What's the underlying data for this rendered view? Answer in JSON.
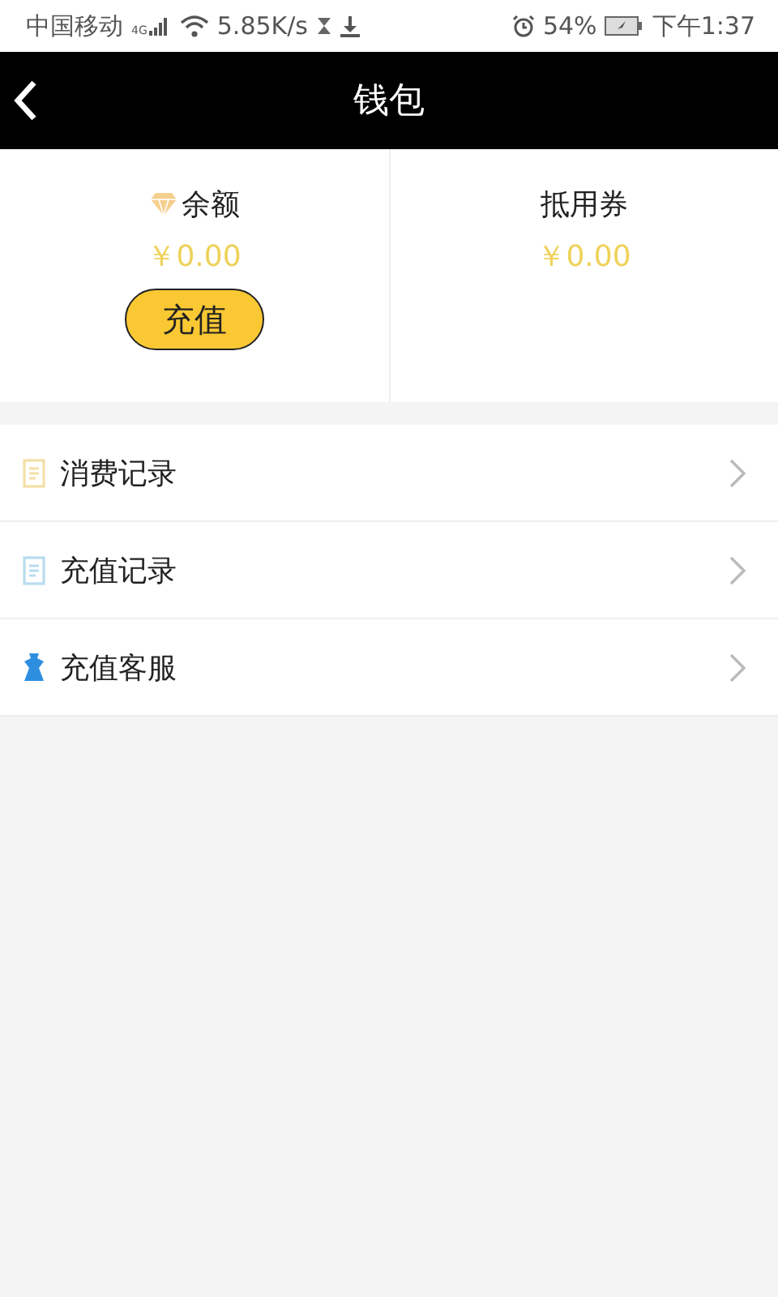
{
  "status_bar": {
    "carrier": "中国移动",
    "network": "4G",
    "speed": "5.85K/s",
    "battery": "54%",
    "time": "下午1:37"
  },
  "header": {
    "title": "钱包"
  },
  "balances": [
    {
      "kind": "balance",
      "label": "余额",
      "amount": "￥0.00",
      "button": "充值"
    },
    {
      "kind": "voucher",
      "label": "抵用券",
      "amount": "￥0.00"
    }
  ],
  "menu": [
    {
      "kind": "document",
      "color": "#f3dfa6",
      "label": "消费记录"
    },
    {
      "kind": "document",
      "color": "#b9dcef",
      "label": "充值记录"
    },
    {
      "kind": "person",
      "color": "#2e8fe0",
      "label": "充值客服"
    }
  ]
}
